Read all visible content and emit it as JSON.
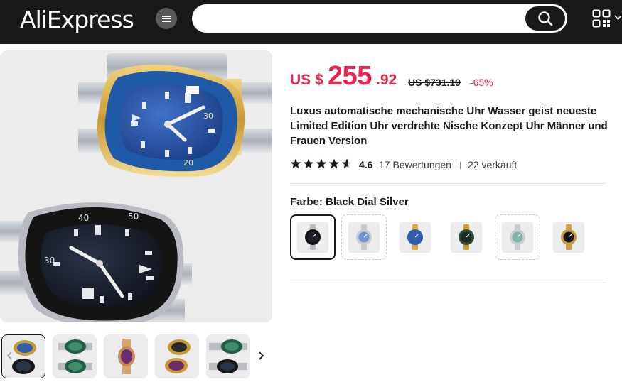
{
  "header": {
    "logo": "AliExpress",
    "search": {
      "placeholder": "",
      "value": ""
    }
  },
  "gallery": {
    "thumbnail_count": 5,
    "active_thumbnail": 1
  },
  "price": {
    "prefix": "US $",
    "integer": "255",
    "decimal": ".92",
    "original": "US $731.19",
    "discount": "-65%",
    "color": "#e8234d"
  },
  "product": {
    "title": "Luxus automatische mechanische Uhr Wasser geist neueste Limited Edition Uhr verdrehte Nische Konzept Uhr Männer und Frauen Version"
  },
  "rating": {
    "stars": 4.6,
    "value": "4.6",
    "reviews": "17 Bewertungen",
    "sold": "22 verkauft"
  },
  "color_selector": {
    "label": "Farbe: Black Dial Silver",
    "selected_index": 0,
    "options": [
      {
        "name": "black-dial-silver",
        "dial": "#1c1f2a",
        "bezel": "#141414",
        "band": "#b9bcc1"
      },
      {
        "name": "blue-dial-silver",
        "dial": "#6f94c9",
        "bezel": "#c7cdd6",
        "band": "#c6c9ce"
      },
      {
        "name": "blue-dial-gold",
        "dial": "#2f5fae",
        "bezel": "#2f5fae",
        "band": "#d6ab3e"
      },
      {
        "name": "black-dial-gold",
        "dial": "#1e2a24",
        "bezel": "#2a4a3a",
        "band": "#c99a2e"
      },
      {
        "name": "teal-dial-silver",
        "dial": "#7fb7ad",
        "bezel": "#c9ced3",
        "band": "#c9ccd0"
      },
      {
        "name": "black-dial-rosegold",
        "dial": "#15161b",
        "bezel": "#c99a3a",
        "band": "#c9a04c"
      }
    ]
  },
  "colors": {
    "header_bg": "#191919",
    "accent": "#e8234d"
  }
}
